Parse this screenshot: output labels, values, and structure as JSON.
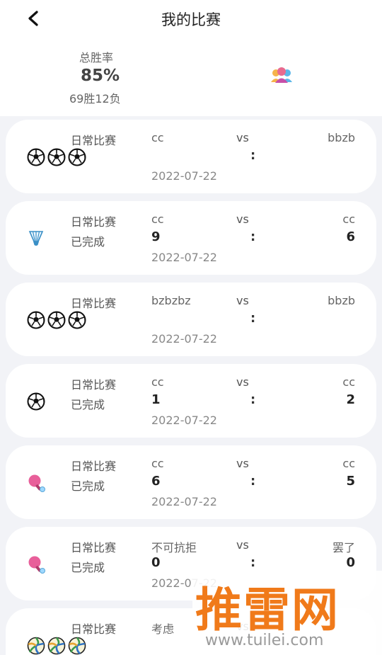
{
  "header": {
    "title": "我的比赛"
  },
  "summary": {
    "label": "总胜率",
    "percentage": "85%",
    "record": "69胜12负"
  },
  "matches": [
    {
      "type": "日常比赛",
      "status": "",
      "home": "cc",
      "vs": "vs",
      "away": "bbzb",
      "home_score": "",
      "colon": ":",
      "away_score": "",
      "date": "2022-07-22",
      "icons": [
        "soccer-ball-icon",
        "soccer-ball-icon",
        "soccer-ball-icon"
      ]
    },
    {
      "type": "日常比赛",
      "status": "已完成",
      "home": "cc",
      "vs": "vs",
      "away": "cc",
      "home_score": "9",
      "colon": ":",
      "away_score": "6",
      "date": "2022-07-22",
      "icons": [
        "shuttlecock-icon"
      ]
    },
    {
      "type": "日常比赛",
      "status": "",
      "home": "bzbzbz",
      "vs": "vs",
      "away": "bbzb",
      "home_score": "",
      "colon": ":",
      "away_score": "",
      "date": "2022-07-22",
      "icons": [
        "soccer-ball-icon",
        "soccer-ball-icon",
        "soccer-ball-icon"
      ]
    },
    {
      "type": "日常比赛",
      "status": "已完成",
      "home": "cc",
      "vs": "vs",
      "away": "cc",
      "home_score": "1",
      "colon": ":",
      "away_score": "2",
      "date": "2022-07-22",
      "icons": [
        "soccer-ball-icon"
      ]
    },
    {
      "type": "日常比赛",
      "status": "已完成",
      "home": "cc",
      "vs": "vs",
      "away": "cc",
      "home_score": "6",
      "colon": ":",
      "away_score": "5",
      "date": "2022-07-22",
      "icons": [
        "ping-pong-paddle-icon"
      ]
    },
    {
      "type": "日常比赛",
      "status": "已完成",
      "home": "不可抗拒",
      "vs": "vs",
      "away": "罢了",
      "home_score": "0",
      "colon": ":",
      "away_score": "0",
      "date": "2022-07-22",
      "icons": [
        "ping-pong-paddle-icon"
      ]
    },
    {
      "type": "日常比赛",
      "status": "",
      "home": "考虑",
      "vs": "vs",
      "away": "",
      "home_score": "",
      "colon": "",
      "away_score": "",
      "date": "",
      "icons": [
        "volleyball-icon",
        "volleyball-icon",
        "volleyball-icon"
      ]
    }
  ],
  "watermark": {
    "brand": "推雷网",
    "url": "www.tuilei.com"
  }
}
